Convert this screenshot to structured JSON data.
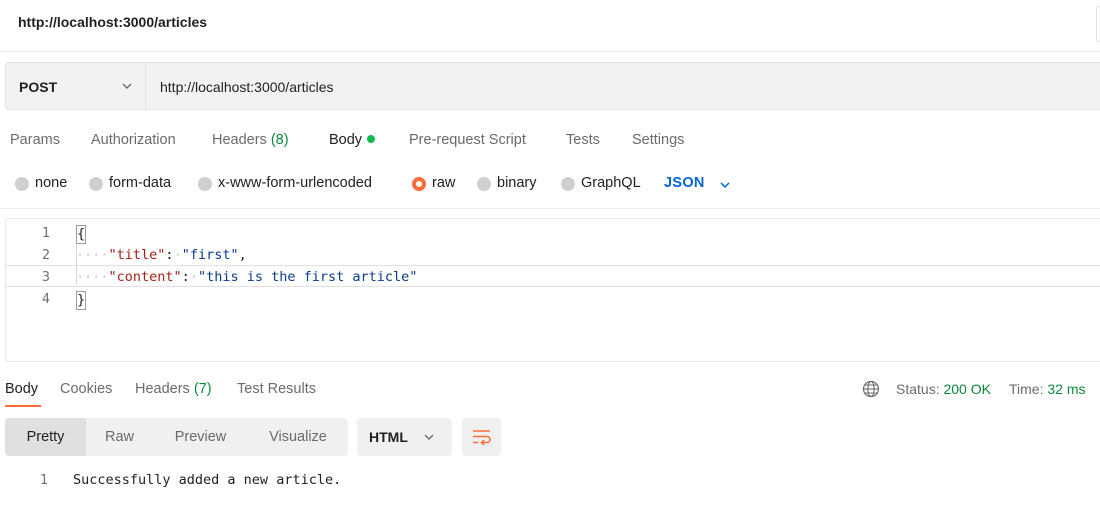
{
  "header": {
    "title": "http://localhost:3000/articles"
  },
  "request": {
    "method": "POST",
    "url": "http://localhost:3000/articles"
  },
  "request_tabs": [
    {
      "label": "Params"
    },
    {
      "label": "Authorization"
    },
    {
      "label": "Headers",
      "count": "(8)"
    },
    {
      "label": "Body",
      "active": true,
      "indicator": "green-dot"
    },
    {
      "label": "Pre-request Script"
    },
    {
      "label": "Tests"
    },
    {
      "label": "Settings"
    }
  ],
  "body_types": [
    {
      "label": "none",
      "selected": false
    },
    {
      "label": "form-data",
      "selected": false
    },
    {
      "label": "x-www-form-urlencoded",
      "selected": false
    },
    {
      "label": "raw",
      "selected": true
    },
    {
      "label": "binary",
      "selected": false
    },
    {
      "label": "GraphQL",
      "selected": false
    }
  ],
  "raw_format": "JSON",
  "editor": {
    "lines": [
      {
        "num": "1",
        "text": "{"
      },
      {
        "num": "2",
        "key": "\"title\"",
        "value": "\"first\"",
        "trailing": ","
      },
      {
        "num": "3",
        "key": "\"content\"",
        "value": "\"this is the first article\"",
        "trailing": ""
      },
      {
        "num": "4",
        "text": "}"
      }
    ]
  },
  "response_tabs": [
    {
      "label": "Body",
      "active": true
    },
    {
      "label": "Cookies"
    },
    {
      "label": "Headers",
      "count": "(7)"
    },
    {
      "label": "Test Results"
    }
  ],
  "response_status": {
    "status_label": "Status:",
    "status_value": "200 OK",
    "time_label": "Time:",
    "time_value": "32 ms"
  },
  "view_modes": [
    {
      "label": "Pretty",
      "active": true
    },
    {
      "label": "Raw"
    },
    {
      "label": "Preview"
    },
    {
      "label": "Visualize"
    }
  ],
  "response_format": "HTML",
  "response_body": {
    "lines": [
      {
        "num": "1",
        "text": "Successfully added a new article."
      }
    ]
  },
  "colors": {
    "accent": "#ff6c37",
    "success": "#0a8a3a",
    "link_blue": "#0265d2",
    "json_key": "#a3241b",
    "json_string": "#0b3c8c"
  },
  "icons": {
    "method_dropdown": "chevron-down-icon",
    "format_dropdown": "chevron-down-icon",
    "network": "globe-icon",
    "wrap": "wrap-lines-icon"
  }
}
